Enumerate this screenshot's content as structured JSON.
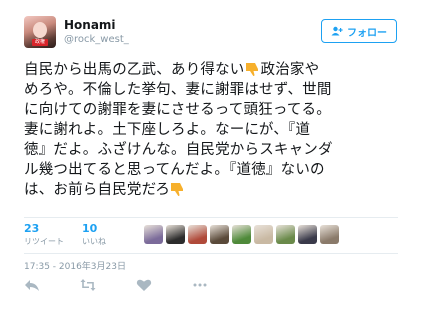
{
  "user": {
    "display_name": "Honami",
    "handle": "@rock_west_",
    "avatar_label": "政権"
  },
  "follow_button": {
    "label": "フォロー"
  },
  "tweet": {
    "lines": [
      "自民から出馬の乙武、あり得ない",
      "政治家や",
      "めろや。不倫した挙句、妻に謝罪はせず、世間",
      "に向けての謝罪を妻にさせるって頭狂ってる。",
      "妻に謝れよ。土下座しろよ。なーにが、『道",
      "徳』だよ。ふざけんな。自民党からスキャンダ",
      "ル幾つ出てると思ってんだよ。『道徳』ないの",
      "は、お前ら自民党だろ"
    ],
    "emoji": [
      "thumbs-down",
      "thumbs-down"
    ]
  },
  "stats": {
    "retweets_count": "23",
    "retweets_label": "リツイート",
    "likes_count": "10",
    "likes_label": "いいね"
  },
  "likers": [
    {
      "color": "#7b6b9a"
    },
    {
      "color": "#2c2c2c"
    },
    {
      "color": "#b04a3a"
    },
    {
      "color": "#5a4a3a"
    },
    {
      "color": "#4f8a3a"
    },
    {
      "color": "#c9b9a3"
    },
    {
      "color": "#6a8a4a"
    },
    {
      "color": "#3a3a4a"
    },
    {
      "color": "#8a7a6a"
    }
  ],
  "timestamp": "17:35 - 2016年3月23日",
  "actions": [
    "reply-icon",
    "retweet-icon",
    "like-icon",
    "more-icon"
  ],
  "colors": {
    "accent": "#1da1f2",
    "muted": "#8899a6",
    "emoji": "#f7b02c"
  }
}
